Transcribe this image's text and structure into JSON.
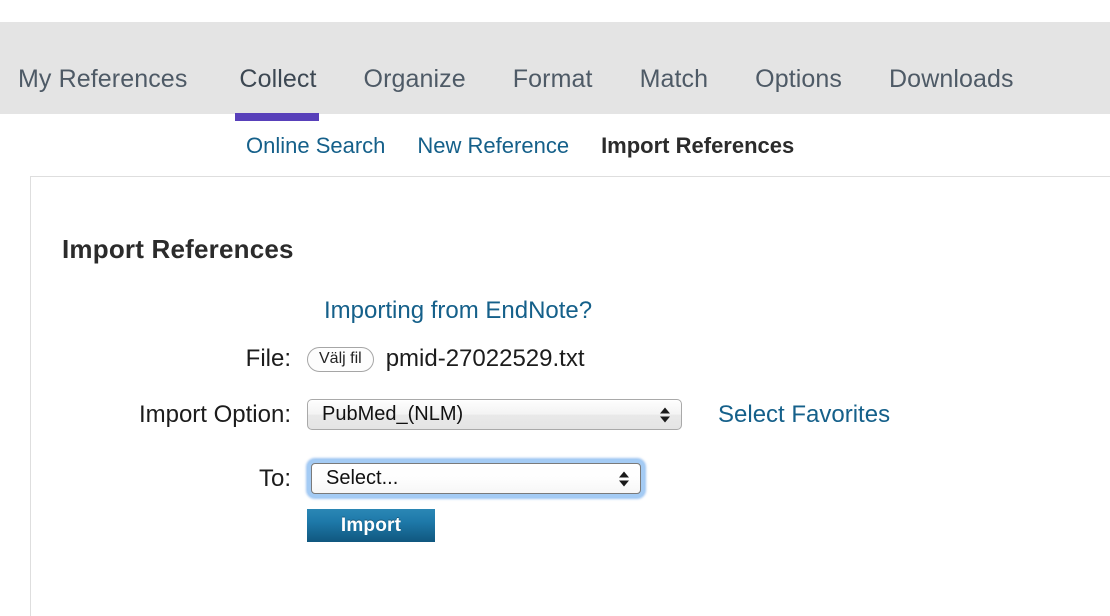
{
  "main_nav": {
    "items": [
      {
        "label": "My References",
        "active": false
      },
      {
        "label": "Collect",
        "active": true
      },
      {
        "label": "Organize",
        "active": false
      },
      {
        "label": "Format",
        "active": false
      },
      {
        "label": "Match",
        "active": false
      },
      {
        "label": "Options",
        "active": false
      },
      {
        "label": "Downloads",
        "active": false
      }
    ],
    "active_underline_color": "#5840ba",
    "bar_background": "#e4e4e4"
  },
  "sub_nav": {
    "items": [
      {
        "label": "Online Search",
        "active": false
      },
      {
        "label": "New Reference",
        "active": false
      },
      {
        "label": "Import References",
        "active": true
      }
    ],
    "link_color": "#15608a"
  },
  "page": {
    "title": "Import References",
    "endnote_link": "Importing from EndNote?"
  },
  "form": {
    "file": {
      "label": "File:",
      "chooser_button": "Välj fil",
      "file_name": "pmid-27022529.txt"
    },
    "import_option": {
      "label": "Import Option:",
      "value": "PubMed_(NLM)",
      "favorites_link": "Select Favorites"
    },
    "to": {
      "label": "To:",
      "value": "Select...",
      "focused": true
    },
    "submit_button": "Import",
    "submit_button_color": "#1e79a9"
  }
}
